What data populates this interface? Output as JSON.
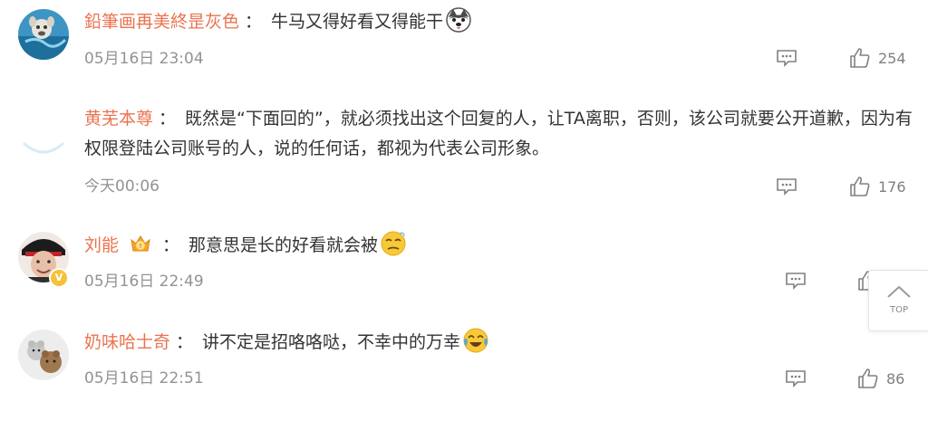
{
  "comments": [
    {
      "username": "鉛筆画再美終昰灰色",
      "separator": "：",
      "text": "牛马又得好看又得能干",
      "emoji": "husky-face-icon",
      "time": "05月16日 23:04",
      "likes": "254"
    },
    {
      "username": "黄芜本尊",
      "separator": "：",
      "text": "既然是“下面回的”，就必须找出这个回复的人，让TA离职，否则，该公司就要公开道歉，因为有权限登陆公司账号的人，说的任何话，都视为代表公司形象。",
      "time": "今天00:06",
      "likes": "176"
    },
    {
      "username": "刘能",
      "separator": "：",
      "text": "那意思是长的好看就会被",
      "emoji": "dizzy-face-icon",
      "badge": "vip-crown-badge-icon",
      "time": "05月16日 22:49",
      "likes": ""
    },
    {
      "username": "奶味哈士奇",
      "separator": "：",
      "text": "讲不定是招咯咯哒，不幸中的万幸",
      "emoji": "laughing-tears-icon",
      "time": "05月16日 22:51",
      "likes": "86"
    }
  ],
  "back_to_top": {
    "label": "TOP"
  },
  "colors": {
    "username": "#eb7350",
    "meta": "#939393",
    "text": "#333333"
  }
}
